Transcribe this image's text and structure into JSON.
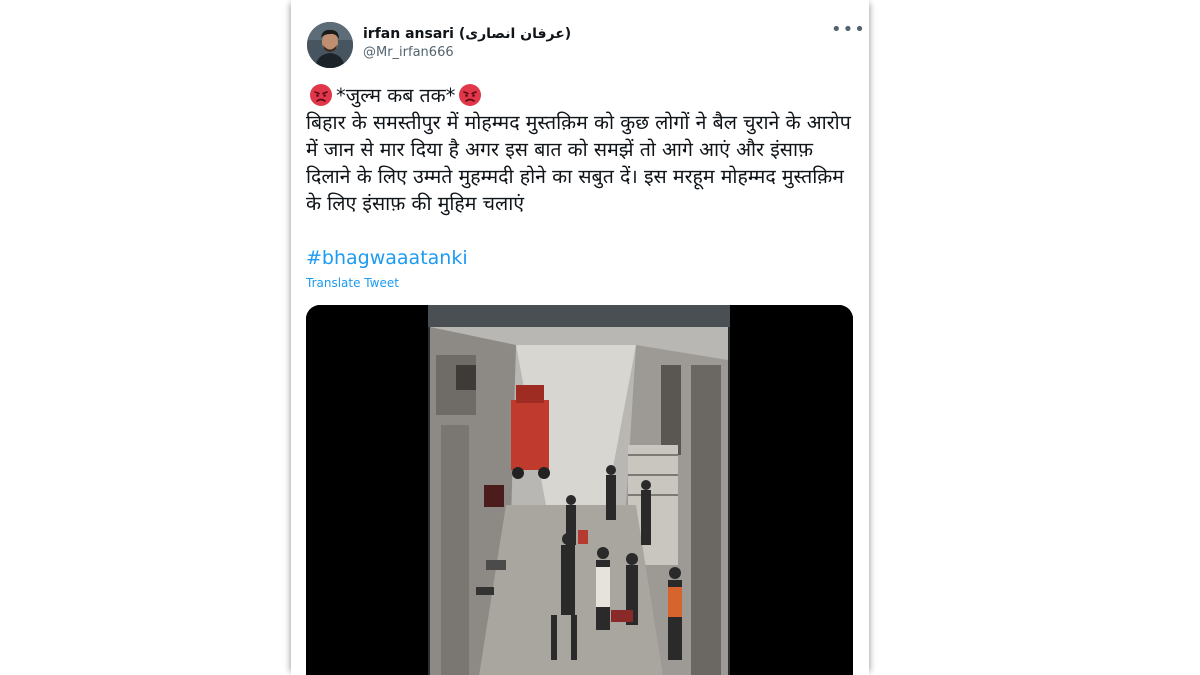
{
  "user": {
    "display_name": "irfan ansari (عرفان انصاری)",
    "handle": "@Mr_irfan666",
    "avatar_icon": "profile-photo"
  },
  "menu": {
    "more_label": "•••"
  },
  "tweet": {
    "line_title": "*जुल्म कब तक*",
    "body": "बिहार के समस्तीपुर में मोहम्मद मुस्तक़िम को कुछ लोगों ने बैल चुराने के आरोप में जान से मार दिया है अगर इस बात को समझें तो आगे आएं और इंसाफ़ दिलाने के लिए उम्मते मुहम्मदी होने का सबुत दें। इस मरहूम मोहम्मद मुस्तक़िम के लिए इंसाफ़ की मुहिम चलाएं",
    "hashtag": "#bhagwaaatanki",
    "translate_label": "Translate Tweet",
    "emoji_icon": "angry-face-emoji"
  },
  "media": {
    "type": "video",
    "description_icon": "cctv-video-thumbnail"
  },
  "colors": {
    "link": "#1d9bf0",
    "text": "#0f1419",
    "secondary": "#536471"
  }
}
